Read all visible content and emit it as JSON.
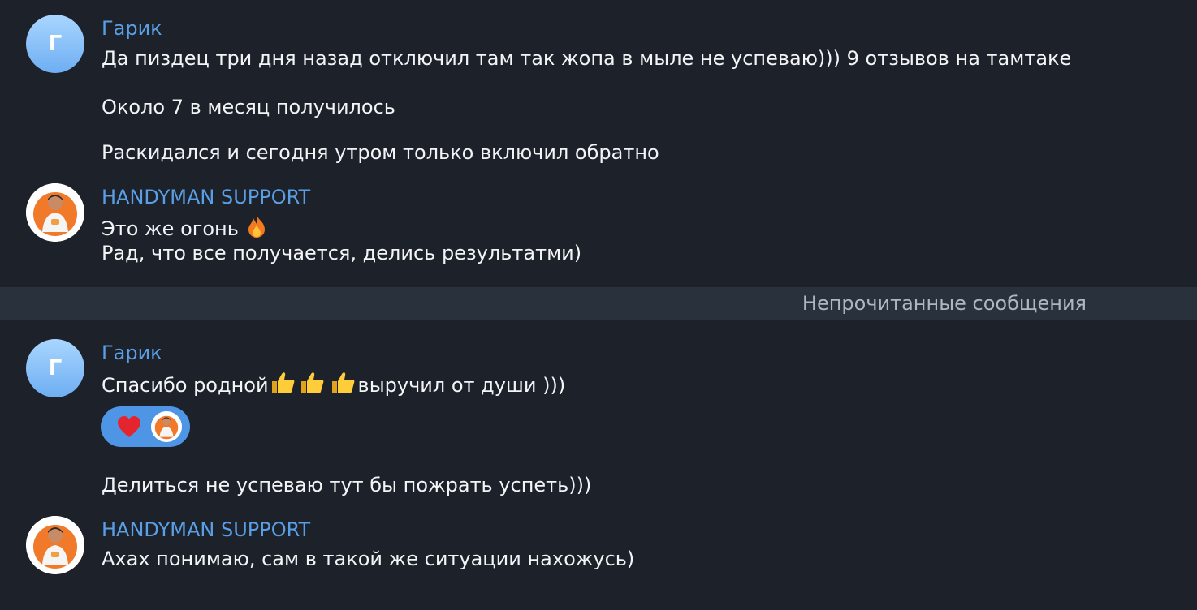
{
  "divider": {
    "label": "Непрочитанные сообщения"
  },
  "messages": [
    {
      "sender": "Гарик",
      "avatar_letter": "Г",
      "lines": [
        "Да пиздец три дня назад отключил там так жопа в мыле не успеваю))) 9 отзывов на тамтаке",
        "Около 7 в месяц получилось",
        "Раскидался и сегодня утром только включил обратно"
      ]
    },
    {
      "sender": "HANDYMAN SUPPORT",
      "avatar_icon": "support-avatar-photo",
      "line1": "Это же огонь",
      "line1_emoji": "fire-emoji",
      "line2": "Рад, что все получается, делись результатми)"
    },
    {
      "sender": "Гарик",
      "avatar_letter": "Г",
      "line1_prefix": "Спасибо родной",
      "line1_emoji": "thumbs-up-emoji x3",
      "line1_suffix": "выручил от души )))",
      "reaction_emoji": "heart-emoji",
      "line2": "Делиться не успеваю тут бы пожрать успеть)))"
    },
    {
      "sender": "HANDYMAN SUPPORT",
      "avatar_icon": "support-avatar-photo",
      "line1": "Ахах понимаю, сам в такой же ситуации нахожусь)"
    }
  ],
  "colors": {
    "background": "#1c212a",
    "sender_name": "#5a9ee4",
    "message_text": "#f2f4f6",
    "divider_bg": "#29313c",
    "reaction_bg": "#4f95e6"
  }
}
